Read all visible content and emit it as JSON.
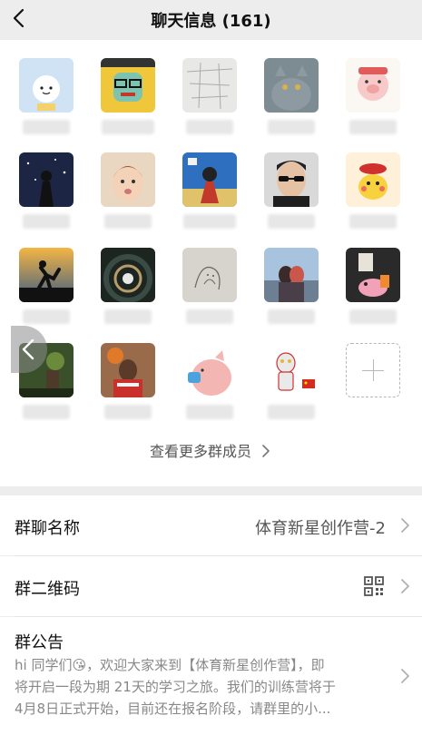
{
  "header": {
    "title": "聊天信息 (161)"
  },
  "members": {
    "more_label": "查看更多群成员"
  },
  "settings": {
    "group_name_label": "群聊名称",
    "group_name_value": "体育新星创作营-2",
    "qr_label": "群二维码",
    "notice_label": "群公告",
    "notice_text_1": "hi 同学们😘，欢迎大家来到【体育新星创作营】，即",
    "notice_text_2": "将开启一段为期 21天的学习之旅。我们的训练营将于",
    "notice_text_3": "4月8日正式开始，目前还在报名阶段，请群里的小..."
  }
}
